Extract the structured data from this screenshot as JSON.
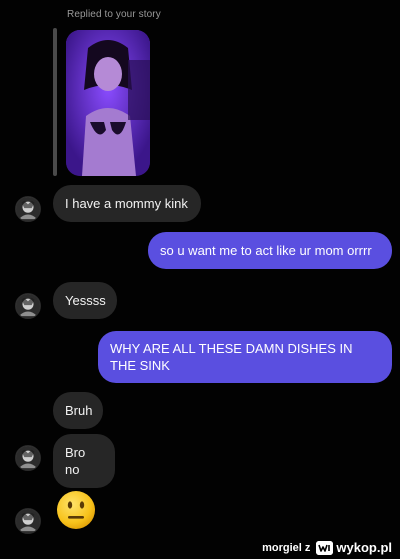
{
  "story": {
    "reply_label": "Replied to your story",
    "thumbnail_icon": "story-photo"
  },
  "messages": [
    {
      "id": "m1",
      "side": "in",
      "text": "I have a mommy kink"
    },
    {
      "id": "m2",
      "side": "out",
      "text": "so u want me to act like ur mom orrrr"
    },
    {
      "id": "m3",
      "side": "in",
      "text": "Yessss"
    },
    {
      "id": "m4",
      "side": "out",
      "text": "WHY ARE ALL THESE DAMN DISHES IN THE SINK"
    },
    {
      "id": "m5",
      "side": "in",
      "text": "Bruh"
    },
    {
      "id": "m6",
      "side": "in",
      "text": "Bro no"
    },
    {
      "id": "m7",
      "side": "in",
      "emoji": "neutral-face"
    }
  ],
  "watermark": {
    "user": "morgiel z",
    "site": "wykop.pl"
  },
  "colors": {
    "background": "#020202",
    "incoming_bubble": "#262626",
    "outgoing_bubble": "#5a4fe0"
  }
}
